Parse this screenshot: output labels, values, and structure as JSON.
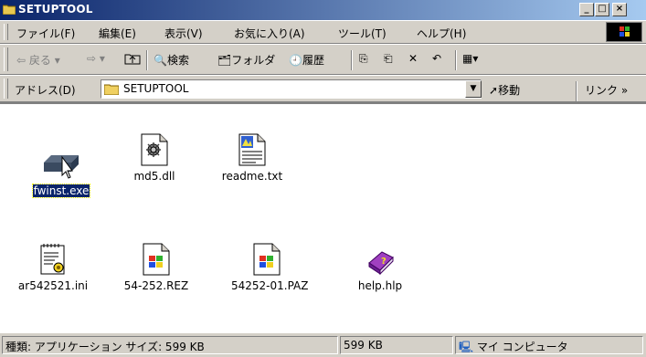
{
  "window": {
    "title": "SETUPTOOL",
    "min_label": "_",
    "max_label": "□",
    "close_label": "×"
  },
  "menu": [
    "ファイル(F)",
    "編集(E)",
    "表示(V)",
    "お気に入り(A)",
    "ツール(T)",
    "ヘルプ(H)"
  ],
  "toolbar": {
    "back": "戻る",
    "search": "検索",
    "folders": "フォルダ",
    "history": "履歴"
  },
  "address": {
    "label": "アドレス(D)",
    "value": "SETUPTOOL",
    "go": "移動",
    "links": "リンク »"
  },
  "files": [
    {
      "name": "fwinst.exe",
      "icon": "drive-icon",
      "selected": true
    },
    {
      "name": "md5.dll",
      "icon": "dll-file-icon"
    },
    {
      "name": "readme.txt",
      "icon": "text-file-icon"
    },
    {
      "name": "ar542521.ini",
      "icon": "ini-file-icon"
    },
    {
      "name": "54-252.REZ",
      "icon": "generic-file-icon"
    },
    {
      "name": "54252-01.PAZ",
      "icon": "generic-file-icon"
    },
    {
      "name": "help.hlp",
      "icon": "help-book-icon"
    }
  ],
  "status": {
    "type_text": "種類: アプリケーション サイズ: 599 KB",
    "size_text": "599 KB",
    "zone_text": "マイ コンピュータ"
  },
  "colors": {
    "title_start": "#0a246a",
    "title_end": "#a6caf0",
    "selection": "#0a246a",
    "face": "#d4d0c8"
  }
}
